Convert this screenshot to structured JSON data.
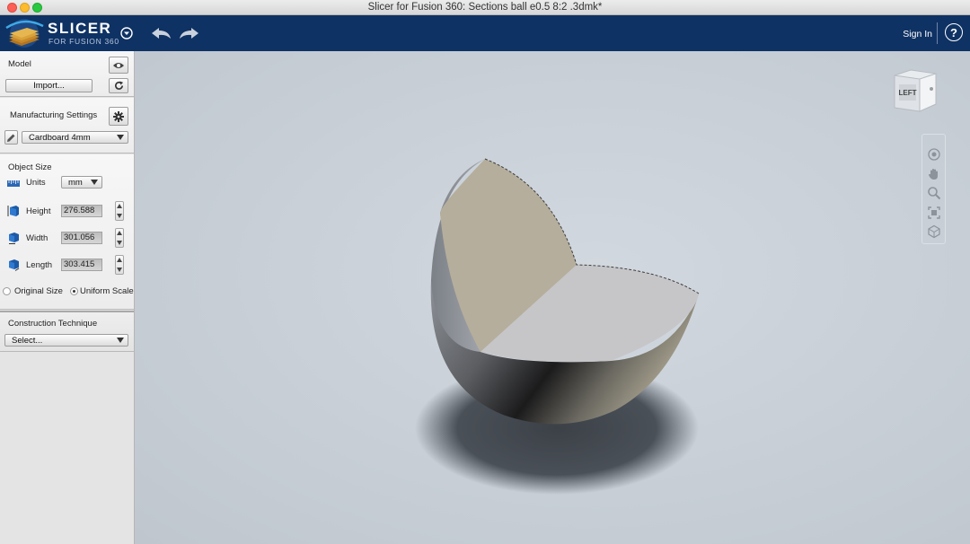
{
  "window": {
    "title": "Slicer for Fusion 360: Sections ball e0.5 8:2 .3dmk*"
  },
  "header": {
    "brand_title": "SLICER",
    "brand_subtitle": "FOR FUSION 360",
    "sign_in": "Sign In",
    "help": "?",
    "brand_color": "#0f3264"
  },
  "sidebar": {
    "model": {
      "label": "Model",
      "import_button": "Import..."
    },
    "manufacturing": {
      "label": "Manufacturing Settings",
      "material": "Cardboard 4mm"
    },
    "object_size": {
      "label": "Object Size",
      "units_label": "Units",
      "units_value": "mm",
      "height_label": "Height",
      "height_value": "276.588",
      "width_label": "Width",
      "width_value": "301.056",
      "length_label": "Length",
      "length_value": "303.415",
      "original_size": "Original Size",
      "uniform_scale": "Uniform Scale",
      "selected_option": "Uniform Scale"
    },
    "construction": {
      "label": "Construction Technique",
      "select_value": "Select..."
    }
  },
  "viewport": {
    "viewcube_face": "LEFT",
    "nav_tools": [
      "orbit-icon",
      "pan-icon",
      "zoom-icon",
      "fit-icon",
      "home-icon"
    ]
  }
}
